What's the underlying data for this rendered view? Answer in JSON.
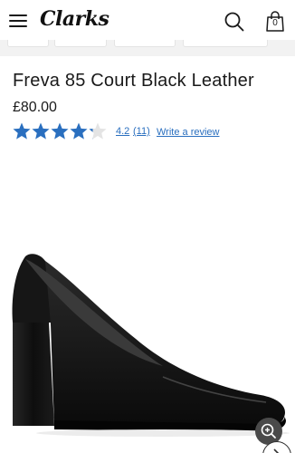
{
  "header": {
    "brand": "Clarks",
    "bag_count": "0",
    "menu_icon": "hamburger-menu-icon",
    "search_icon": "search-icon",
    "bag_icon": "shopping-bag-icon"
  },
  "product": {
    "title": "Freva 85 Court Black Leather",
    "price": "£80.00",
    "image_icon": "black-leather-court-shoe-image"
  },
  "rating": {
    "value": "4.2",
    "count": "(11)",
    "write_review_label": "Write a review",
    "max_stars": 5,
    "star_color": "#2a6fbf"
  },
  "controls": {
    "zoom_icon": "zoom-in-icon",
    "next_icon": "chevron-right-icon"
  }
}
